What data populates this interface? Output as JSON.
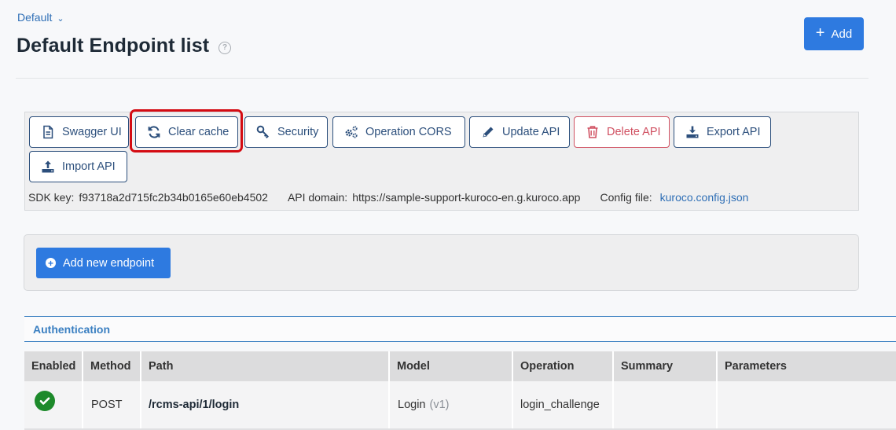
{
  "header": {
    "breadcrumb": "Default",
    "title": "Default Endpoint list",
    "add_label": "Add"
  },
  "toolbar": {
    "buttons": {
      "swagger": "Swagger UI",
      "clear_cache": "Clear cache",
      "security": "Security",
      "operation_cors": "Operation CORS",
      "update_api": "Update API",
      "delete_api": "Delete API",
      "export_api": "Export API",
      "import_api": "Import API"
    },
    "meta": {
      "sdk_key_label": "SDK key:",
      "sdk_key": "f93718a2d715fc2b34b0165e60eb4502",
      "api_domain_label": "API domain:",
      "api_domain": "https://sample-support-kuroco-en.g.kuroco.app",
      "config_file_label": "Config file:",
      "config_file": "kuroco.config.json"
    }
  },
  "endpoints": {
    "add_new_label": "Add new endpoint"
  },
  "section": {
    "title": "Authentication"
  },
  "table": {
    "columns": {
      "enabled": "Enabled",
      "method": "Method",
      "path": "Path",
      "model": "Model",
      "operation": "Operation",
      "summary": "Summary",
      "parameters": "Parameters"
    },
    "rows": [
      {
        "enabled": true,
        "method": "POST",
        "path": "/rcms-api/1/login",
        "model": "Login",
        "model_version": "(v1)",
        "operation": "login_challenge",
        "summary": "",
        "parameters": ""
      }
    ]
  },
  "colors": {
    "primary": "#2e7ae0",
    "outline": "#2c4f7c",
    "danger": "#d05061",
    "highlight": "#d40b12",
    "success": "#1d8a2b",
    "link": "#2f6fb6"
  },
  "icons": {
    "help": "question-circle-icon",
    "swagger": "document-icon",
    "clear_cache": "refresh-icon",
    "security": "key-icon",
    "operation_cors": "gears-icon",
    "update_api": "pencil-icon",
    "delete_api": "trash-icon",
    "export_api": "download-icon",
    "import_api": "upload-icon",
    "enabled": "check-circle-icon"
  }
}
